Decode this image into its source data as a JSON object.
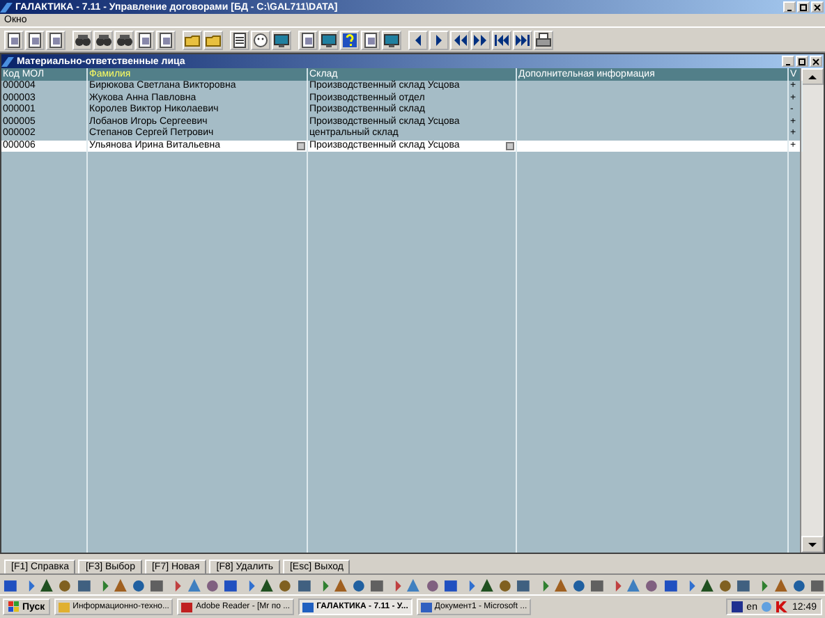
{
  "window": {
    "title": "ГАЛАКТИКА - 7.11 - Управление договорами [БД - C:\\GAL711\\DATA]"
  },
  "menu": [
    "Окно"
  ],
  "child_window": {
    "title": "Материально-ответственные лица"
  },
  "table": {
    "columns": [
      {
        "label": "Код МОЛ",
        "sorted": false
      },
      {
        "label": "Фамилия",
        "sorted": true
      },
      {
        "label": "Склад",
        "sorted": false
      },
      {
        "label": "Дополнительная информация",
        "sorted": false
      },
      {
        "label": "V",
        "sorted": false
      }
    ],
    "rows": [
      {
        "cells": [
          "000004",
          "Бирюкова Светлана Викторовна",
          "Производственный склад Усцова",
          "",
          "+"
        ],
        "selected": false
      },
      {
        "cells": [
          "000003",
          "Жукова Анна Павловна",
          "Производственный отдел",
          "",
          "+"
        ],
        "selected": false
      },
      {
        "cells": [
          "000001",
          "Королев Виктор Николаевич",
          "Производственный склад",
          "",
          "-"
        ],
        "selected": false
      },
      {
        "cells": [
          "000005",
          "Лобанов Игорь Сергеевич",
          "Производственный склад Усцова",
          "",
          "+"
        ],
        "selected": false
      },
      {
        "cells": [
          "000002",
          "Степанов Сергей Петрович",
          "центральный склад",
          "",
          "+"
        ],
        "selected": false
      },
      {
        "cells": [
          "000006",
          "Ульянова Ирина Витальевна",
          "Производственный склад Усцова",
          "",
          "+"
        ],
        "selected": true
      }
    ]
  },
  "function_keys": [
    "[F1] Справка",
    "[F3] Выбор",
    "[F7] Новая",
    "[F8] Удалить",
    "[Esc] Выход"
  ],
  "taskbar": {
    "start": "Пуск",
    "tasks": [
      {
        "label": "Информационно-техно...",
        "selected": false
      },
      {
        "label": "Adobe Reader - [Mr по ...",
        "selected": false
      },
      {
        "label": "ГАЛАКТИКА - 7.11 - У...",
        "selected": true
      },
      {
        "label": "Документ1 - Microsoft ...",
        "selected": false
      }
    ],
    "language": "en",
    "clock": "12:49"
  }
}
